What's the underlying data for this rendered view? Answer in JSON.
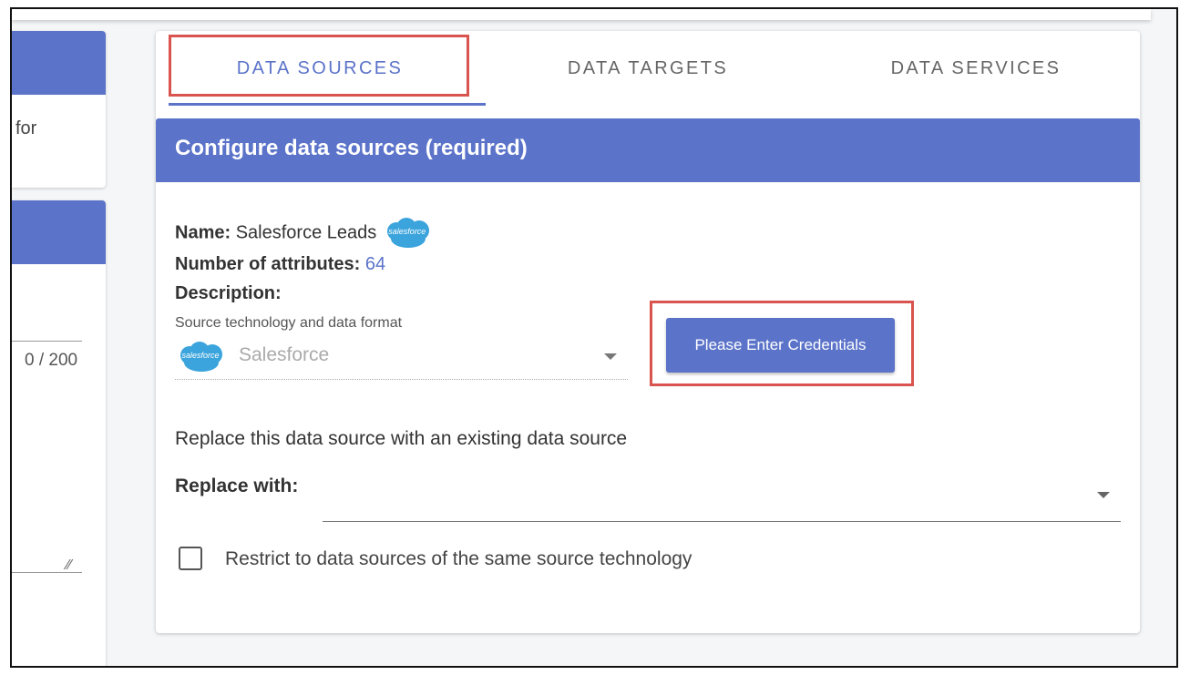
{
  "left_panel": {
    "truncated_text": "for",
    "char_count": "0 / 200"
  },
  "tabs": [
    {
      "label": "DATA SOURCES",
      "active": true
    },
    {
      "label": "DATA TARGETS",
      "active": false
    },
    {
      "label": "DATA SERVICES",
      "active": false
    }
  ],
  "section": {
    "title": "Configure data sources (required)"
  },
  "details": {
    "name_label": "Name:",
    "name_value": "Salesforce Leads",
    "attributes_label": "Number of attributes:",
    "attributes_value": "64",
    "description_label": "Description:"
  },
  "source_tech": {
    "label": "Source technology and data format",
    "value": "Salesforce",
    "logo_text": "salesforce"
  },
  "credentials_button": "Please Enter Credentials",
  "replace": {
    "text": "Replace this data source with an existing data source",
    "label": "Replace with:",
    "value": ""
  },
  "restrict": {
    "label": "Restrict to data sources of the same source technology",
    "checked": false
  },
  "colors": {
    "primary": "#5b73c9",
    "highlight": "#d9534f",
    "salesforce": "#3ba4dc"
  }
}
